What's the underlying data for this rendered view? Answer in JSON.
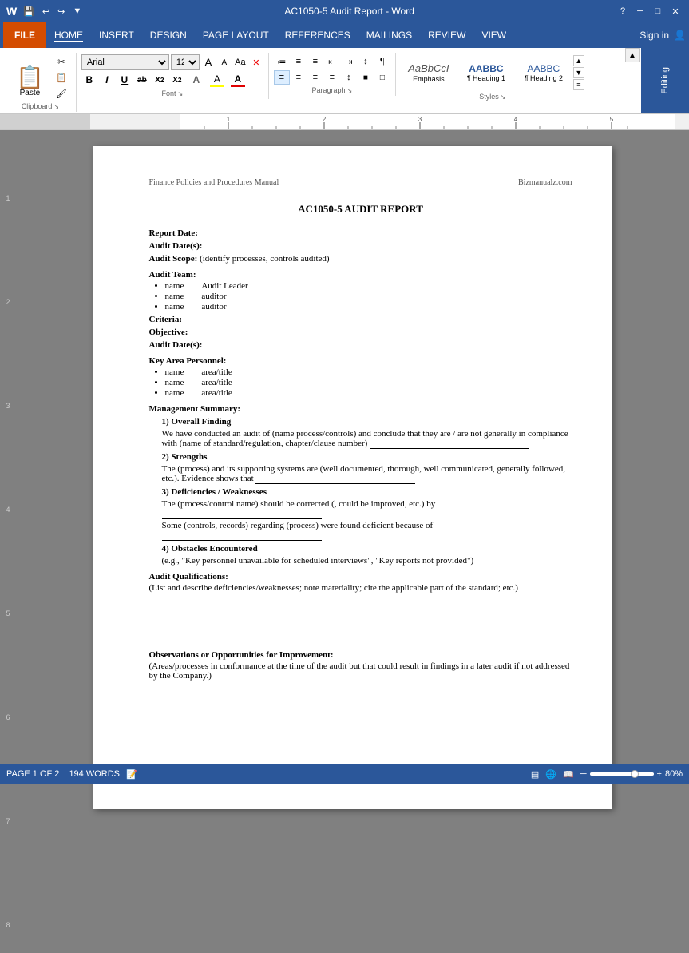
{
  "titlebar": {
    "title": "AC1050-5 Audit Report - Word",
    "help_icon": "?",
    "minimize": "─",
    "restore": "□",
    "close": "✕",
    "quick_save": "💾",
    "quick_undo": "↩",
    "quick_redo": "↪",
    "quick_customize": "▼"
  },
  "menu": {
    "file": "FILE",
    "tabs": [
      "HOME",
      "INSERT",
      "DESIGN",
      "PAGE LAYOUT",
      "REFERENCES",
      "MAILINGS",
      "REVIEW",
      "VIEW"
    ],
    "signin": "Sign in",
    "user_icon": "👤"
  },
  "ribbon": {
    "clipboard": {
      "label": "Clipboard",
      "paste": "Paste",
      "cut": "✂",
      "copy": "📋",
      "format_painter": "🖌"
    },
    "font": {
      "label": "Font",
      "family": "Arial",
      "size": "12",
      "grow": "A",
      "shrink": "A",
      "change_case": "Aa",
      "clear": "✕",
      "bold": "B",
      "italic": "I",
      "underline": "U",
      "strikethrough": "ab",
      "subscript": "X₂",
      "superscript": "X²",
      "text_effects": "A",
      "highlight": "A",
      "color": "A"
    },
    "paragraph": {
      "label": "Paragraph",
      "bullets": "≡",
      "numbering": "≡",
      "multilevel": "≡",
      "decrease_indent": "←",
      "increase_indent": "→",
      "sort": "↕",
      "show_marks": "¶",
      "align_left": "≡",
      "align_center": "≡",
      "align_right": "≡",
      "justify": "≡",
      "line_spacing": "↕",
      "shading": "■",
      "borders": "□"
    },
    "styles": {
      "label": "Styles",
      "items": [
        {
          "name": "emphasis-style",
          "preview": "AaBbCcI",
          "label": "Emphasis"
        },
        {
          "name": "heading1-style",
          "preview": "AABBC",
          "label": "¶ Heading 1"
        },
        {
          "name": "heading2-style",
          "preview": "AABBC",
          "label": "¶ Heading 2"
        }
      ]
    },
    "editing": {
      "label": "Editing"
    }
  },
  "ruler": {
    "ticks": [
      "1",
      "2",
      "3",
      "4",
      "5"
    ]
  },
  "document": {
    "header_left": "Finance Policies and Procedures Manual",
    "header_right": "Bizmanualz.com",
    "title": "AC1050-5 AUDIT REPORT",
    "sections": [
      {
        "label": "Report Date:",
        "text": ""
      },
      {
        "label": "Audit Date(s):",
        "text": ""
      },
      {
        "label": "Audit Scope:",
        "text": "(identify processes, controls audited)"
      },
      {
        "label": "Audit Team:",
        "text": ""
      },
      {
        "label": "Criteria:",
        "text": ""
      },
      {
        "label": "Objective:",
        "text": ""
      },
      {
        "label": "Audit Date(s):",
        "text": ""
      },
      {
        "label": "Key Area Personnel:",
        "text": ""
      },
      {
        "label": "Management Summary:",
        "text": ""
      }
    ],
    "audit_team_members": [
      {
        "name": "name",
        "role": "Audit Leader"
      },
      {
        "name": "name",
        "role": "auditor"
      },
      {
        "name": "name",
        "role": "auditor"
      }
    ],
    "key_area_personnel": [
      {
        "name": "name",
        "title": "area/title"
      },
      {
        "name": "name",
        "title": "area/title"
      },
      {
        "name": "name",
        "title": "area/title"
      }
    ],
    "management_summary": {
      "finding": {
        "number": "1) Overall Finding",
        "text": "We have conducted an audit of (name process/controls) and conclude that they are / are not generally in compliance with (name of standard/regulation, chapter/clause number)"
      },
      "strengths": {
        "number": "2) Strengths",
        "text": "The (process) and its supporting systems are (well documented, thorough, well communicated, generally followed, etc.).  Evidence shows that"
      },
      "deficiencies": {
        "number": "3) Deficiencies / Weaknesses",
        "line1": "The (process/control name) should be corrected (, could be improved, etc.) by",
        "line2": "Some (controls, records) regarding (process) were found deficient because of"
      },
      "obstacles": {
        "number": "4) Obstacles Encountered",
        "text": "(e.g., \"Key personnel unavailable for scheduled interviews\", \"Key reports not provided\")"
      }
    },
    "audit_qualifications": {
      "label": "Audit Qualifications:",
      "text": "(List and describe deficiencies/weaknesses; note materiality; cite the applicable part of the standard; etc.)"
    },
    "observations": {
      "label": "Observations or Opportunities for Improvement:",
      "text": "(Areas/processes in conformance at the time of the audit but that could result in findings in a later audit if not addressed by the Company.)"
    }
  },
  "statusbar": {
    "page_info": "PAGE 1 OF 2",
    "word_count": "194 WORDS",
    "zoom_level": "80%",
    "zoom_value": "80"
  }
}
